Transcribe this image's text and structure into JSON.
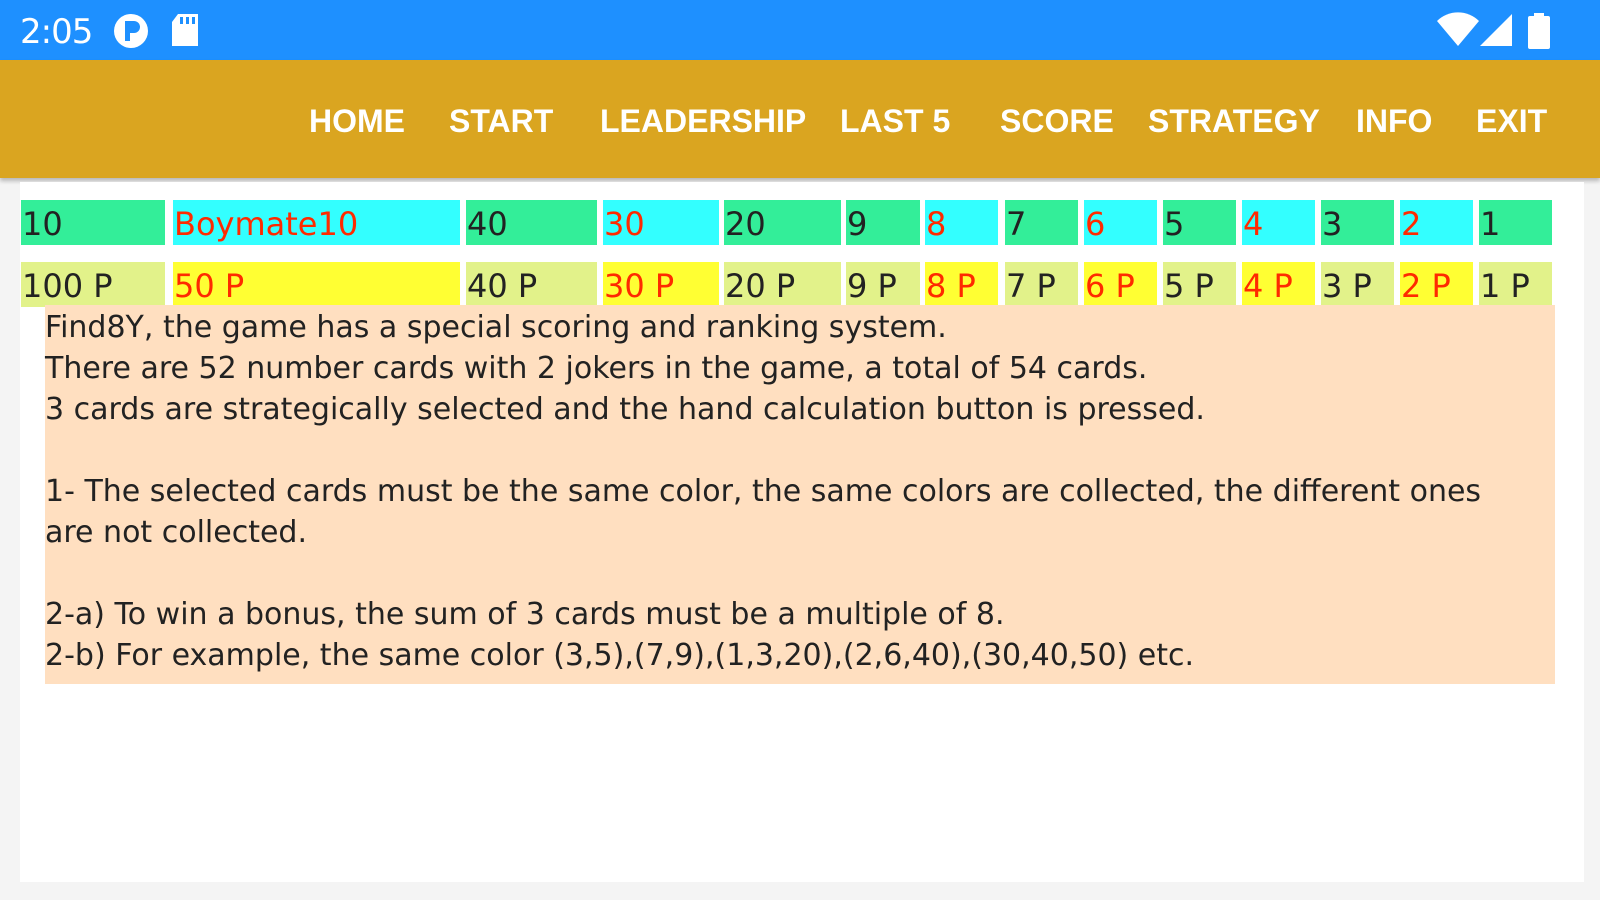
{
  "status_bar": {
    "time": "2:05",
    "icons": [
      "app-p-icon",
      "sd-card-icon",
      "wifi-icon",
      "signal-icon",
      "battery-icon"
    ],
    "background_color": "#1e90ff"
  },
  "nav": {
    "background_color": "#daa520",
    "items": [
      {
        "label": "HOME"
      },
      {
        "label": "START"
      },
      {
        "label": "LEADERSHIP"
      },
      {
        "label": "LAST 5"
      },
      {
        "label": "SCORE"
      },
      {
        "label": "STRATEGY"
      },
      {
        "label": "INFO"
      },
      {
        "label": "EXIT"
      }
    ]
  },
  "ranking": {
    "rank_row": [
      {
        "text": "10",
        "bg": "#33ee99",
        "color": "#222222"
      },
      {
        "text": "Boymate10",
        "bg": "#33ffff",
        "color": "#ff2a00"
      },
      {
        "text": "40",
        "bg": "#33ee99",
        "color": "#222222"
      },
      {
        "text": "30",
        "bg": "#33ffff",
        "color": "#ff2a00"
      },
      {
        "text": "20",
        "bg": "#33ee99",
        "color": "#222222"
      },
      {
        "text": "9",
        "bg": "#33ee99",
        "color": "#222222"
      },
      {
        "text": "8",
        "bg": "#33ffff",
        "color": "#ff2a00"
      },
      {
        "text": "7",
        "bg": "#33ee99",
        "color": "#222222"
      },
      {
        "text": "6",
        "bg": "#33ffff",
        "color": "#ff2a00"
      },
      {
        "text": "5",
        "bg": "#33ee99",
        "color": "#222222"
      },
      {
        "text": "4",
        "bg": "#33ffff",
        "color": "#ff2a00"
      },
      {
        "text": "3",
        "bg": "#33ee99",
        "color": "#222222"
      },
      {
        "text": "2",
        "bg": "#33ffff",
        "color": "#ff2a00"
      },
      {
        "text": "1",
        "bg": "#33ee99",
        "color": "#222222"
      }
    ],
    "points_row": [
      {
        "text": "100 P",
        "bg": "#e2f28a",
        "color": "#222222"
      },
      {
        "text": "50 P",
        "bg": "#ffff33",
        "color": "#ff2a00"
      },
      {
        "text": "40 P",
        "bg": "#e2f28a",
        "color": "#222222"
      },
      {
        "text": "30 P",
        "bg": "#ffff33",
        "color": "#ff2a00"
      },
      {
        "text": "20 P",
        "bg": "#e2f28a",
        "color": "#222222"
      },
      {
        "text": "9 P",
        "bg": "#e2f28a",
        "color": "#222222"
      },
      {
        "text": "8 P",
        "bg": "#ffff33",
        "color": "#ff2a00"
      },
      {
        "text": "7 P",
        "bg": "#e2f28a",
        "color": "#222222"
      },
      {
        "text": "6 P",
        "bg": "#ffff33",
        "color": "#ff2a00"
      },
      {
        "text": "5 P",
        "bg": "#e2f28a",
        "color": "#222222"
      },
      {
        "text": "4 P",
        "bg": "#ffff33",
        "color": "#ff2a00"
      },
      {
        "text": "3 P",
        "bg": "#e2f28a",
        "color": "#222222"
      },
      {
        "text": "2 P",
        "bg": "#ffff33",
        "color": "#ff2a00"
      },
      {
        "text": "1 P",
        "bg": "#e2f28a",
        "color": "#222222"
      }
    ]
  },
  "info_text": {
    "background_color": "#ffdfc0",
    "lines": [
      "Find8Y, the game has a special scoring and ranking system.",
      "There are 52 number cards with 2 jokers in the game, a total of 54 cards.",
      "3 cards are strategically selected and the hand calculation button is pressed.",
      "",
      "1- The selected cards must be the same color, the same colors are collected, the different ones",
      "are not collected.",
      "",
      "2-a) To win a bonus, the sum of 3 cards must be a multiple of 8.",
      "2-b) For example, the same color (3,5),(7,9),(1,3,20),(2,6,40),(30,40,50) etc."
    ]
  }
}
